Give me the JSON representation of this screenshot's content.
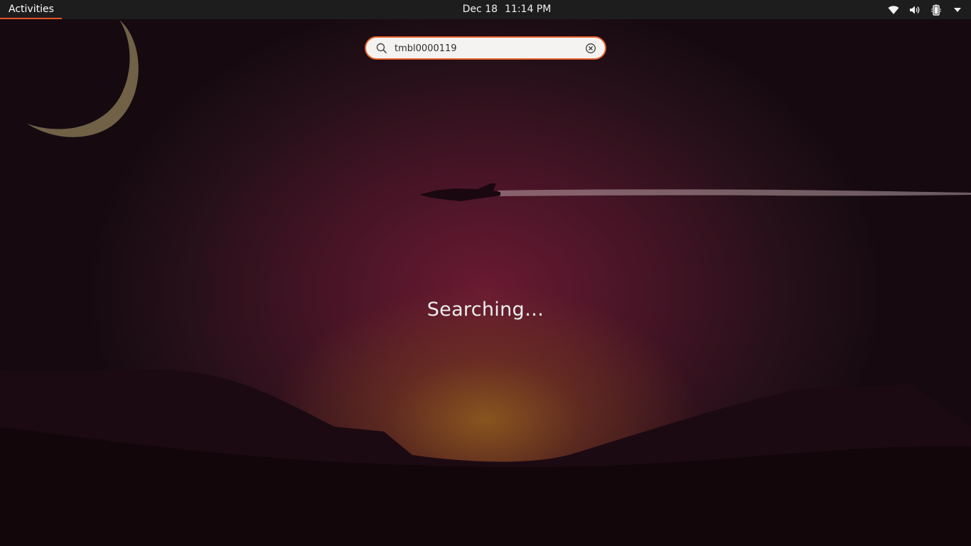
{
  "topbar": {
    "activities_label": "Activities",
    "date": "Dec 18",
    "time": "11:14 PM",
    "tray": [
      "wifi-icon",
      "volume-icon",
      "battery-icon",
      "system-menu-arrow-icon"
    ]
  },
  "search": {
    "value": "tmbl0000119",
    "icon": "search-icon",
    "clear_icon": "clear-icon"
  },
  "status_text": "Searching…",
  "colors": {
    "accent": "#e95420",
    "topbar_bg": "#1d1d1d",
    "wallpaper_glow": "#6a1a32"
  }
}
